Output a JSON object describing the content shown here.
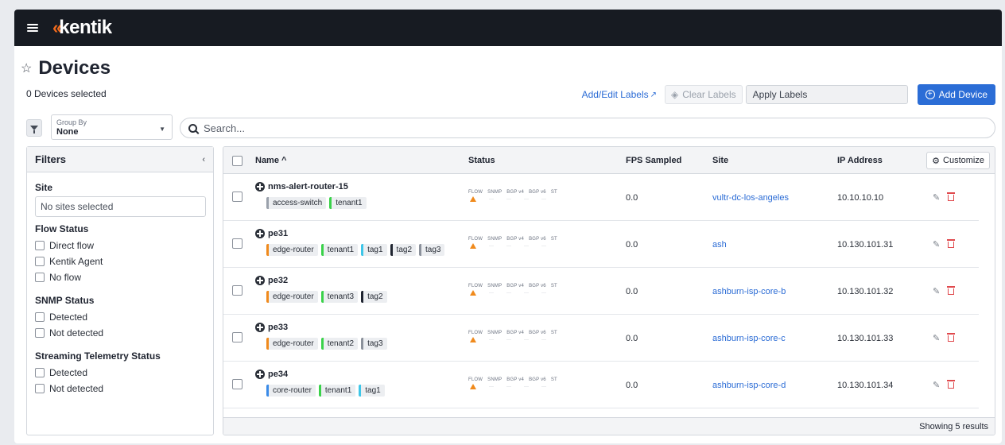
{
  "brand": {
    "name": "kentik",
    "mark": "«"
  },
  "page": {
    "title": "Devices",
    "selected_count": "0 Devices selected"
  },
  "label_actions": {
    "add_edit": "Add/Edit Labels",
    "clear": "Clear Labels",
    "apply_placeholder": "Apply Labels",
    "add_device": "Add Device"
  },
  "toolbar": {
    "group_by_label": "Group By",
    "group_by_value": "None",
    "search_placeholder": "Search..."
  },
  "filters": {
    "title": "Filters",
    "site": {
      "title": "Site",
      "placeholder": "No sites selected"
    },
    "flow_status": {
      "title": "Flow Status",
      "options": [
        "Direct flow",
        "Kentik Agent",
        "No flow"
      ]
    },
    "snmp_status": {
      "title": "SNMP Status",
      "options": [
        "Detected",
        "Not detected"
      ]
    },
    "st_status": {
      "title": "Streaming Telemetry Status",
      "options": [
        "Detected",
        "Not detected"
      ]
    }
  },
  "table": {
    "columns": {
      "name": "Name ^",
      "status": "Status",
      "fps": "FPS Sampled",
      "site": "Site",
      "ip": "IP Address"
    },
    "customize": "Customize",
    "status_heads": [
      "FLOW",
      "SNMP",
      "BGP v4",
      "BGP v6",
      "ST"
    ],
    "status_placeholder": "···",
    "rows": [
      {
        "name": "nms-alert-router-15",
        "labels": [
          {
            "text": "access-switch",
            "color": "#9aa1ab"
          },
          {
            "text": "tenant1",
            "color": "#3ad24a"
          }
        ],
        "fps": "0.0",
        "site": "vultr-dc-los-angeles",
        "ip": "10.10.10.10"
      },
      {
        "name": "pe31",
        "labels": [
          {
            "text": "edge-router",
            "color": "#f08a1c"
          },
          {
            "text": "tenant1",
            "color": "#3ad24a"
          },
          {
            "text": "tag1",
            "color": "#3ec6e8"
          },
          {
            "text": "tag2",
            "color": "#1f2430"
          },
          {
            "text": "tag3",
            "color": "#8b919b"
          }
        ],
        "fps": "0.0",
        "site": "ash",
        "ip": "10.130.101.31"
      },
      {
        "name": "pe32",
        "labels": [
          {
            "text": "edge-router",
            "color": "#f08a1c"
          },
          {
            "text": "tenant3",
            "color": "#3ad24a"
          },
          {
            "text": "tag2",
            "color": "#1f2430"
          }
        ],
        "fps": "0.0",
        "site": "ashburn-isp-core-b",
        "ip": "10.130.101.32"
      },
      {
        "name": "pe33",
        "labels": [
          {
            "text": "edge-router",
            "color": "#f08a1c"
          },
          {
            "text": "tenant2",
            "color": "#3ad24a"
          },
          {
            "text": "tag3",
            "color": "#8b919b"
          }
        ],
        "fps": "0.0",
        "site": "ashburn-isp-core-c",
        "ip": "10.130.101.33"
      },
      {
        "name": "pe34",
        "labels": [
          {
            "text": "core-router",
            "color": "#3a8be8"
          },
          {
            "text": "tenant1",
            "color": "#3ad24a"
          },
          {
            "text": "tag1",
            "color": "#3ec6e8"
          }
        ],
        "fps": "0.0",
        "site": "ashburn-isp-core-d",
        "ip": "10.130.101.34"
      }
    ],
    "footer": "Showing 5 results"
  },
  "colors": {
    "brand_orange": "#f26b1d",
    "topbar": "#171b22",
    "primary": "#2b6dd6",
    "link": "#2a6bd5",
    "warning": "#f08a1c",
    "danger": "#e0494d"
  }
}
